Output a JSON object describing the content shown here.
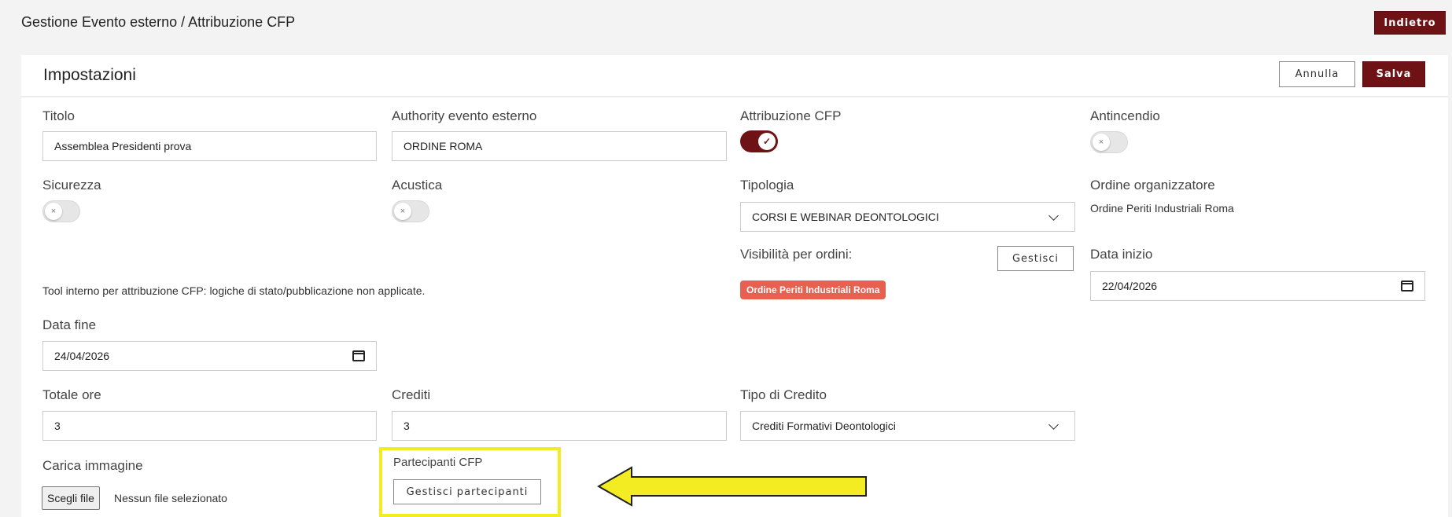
{
  "page": {
    "title": "Gestione Evento esterno / Attribuzione CFP",
    "back_label": "Indietro"
  },
  "panel": {
    "title": "Impostazioni",
    "cancel_label": "Annulla",
    "save_label": "Salva"
  },
  "form": {
    "titolo": {
      "label": "Titolo",
      "value": "Assemblea Presidenti prova"
    },
    "authority": {
      "label": "Authority evento esterno",
      "value": "ORDINE ROMA"
    },
    "attribuzione_cfp": {
      "label": "Attribuzione CFP",
      "on": true
    },
    "antincendio": {
      "label": "Antincendio",
      "on": false
    },
    "sicurezza": {
      "label": "Sicurezza",
      "on": false
    },
    "acustica": {
      "label": "Acustica",
      "on": false
    },
    "tipologia": {
      "label": "Tipologia",
      "value": "CORSI E WEBINAR DEONTOLOGICI"
    },
    "ordine_organizzatore": {
      "label": "Ordine organizzatore",
      "value": "Ordine Periti Industriali Roma"
    },
    "visibilita": {
      "label": "Visibilità per ordini:",
      "manage_label": "Gestisci",
      "chips": [
        "Ordine Periti Industriali Roma"
      ]
    },
    "data_inizio": {
      "label": "Data inizio",
      "value": "22/04/2026"
    },
    "note": "Tool interno per attribuzione CFP: logiche di stato/pubblicazione non applicate.",
    "data_fine": {
      "label": "Data fine",
      "value": "24/04/2026"
    },
    "totale_ore": {
      "label": "Totale ore",
      "value": "3"
    },
    "crediti": {
      "label": "Crediti",
      "value": "3"
    },
    "tipo_credito": {
      "label": "Tipo di Credito",
      "value": "Crediti Formativi Deontologici"
    },
    "carica_immagine": {
      "label": "Carica immagine",
      "button_label": "Scegli file",
      "status": "Nessun file selezionato"
    },
    "partecipanti": {
      "label": "Partecipanti CFP",
      "button_label": "Gestisci partecipanti"
    }
  },
  "colors": {
    "brand": "#6e1215",
    "chip": "#e8604f",
    "highlight": "#f4ec23"
  },
  "icons": [
    "calendar-icon",
    "chevron-down-icon",
    "check-icon",
    "x-icon",
    "arrow-left-icon"
  ]
}
